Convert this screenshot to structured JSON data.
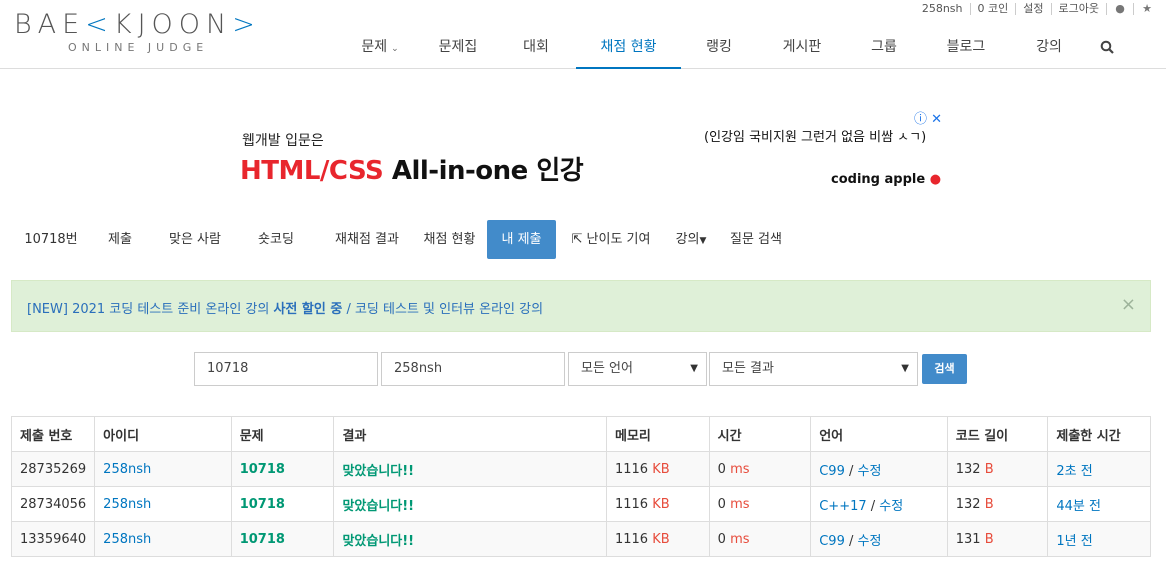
{
  "header": {
    "logo_main_left": "BAE",
    "logo_main_right": "JOON",
    "logo_sub": "ONLINE JUDGE",
    "topbar": {
      "user": "258nsh",
      "coin": "0 코인",
      "settings": "설정",
      "logout": "로그아웃",
      "globe_icon": "globe-icon",
      "star_icon": "star-icon",
      "globe_glyph": "●",
      "star_glyph": "★"
    },
    "nav": [
      {
        "label": "문제"
      },
      {
        "label": "문제집"
      },
      {
        "label": "대회"
      },
      {
        "label": "채점 현황"
      },
      {
        "label": "랭킹"
      },
      {
        "label": "게시판"
      },
      {
        "label": "그룹"
      },
      {
        "label": "블로그"
      },
      {
        "label": "강의"
      }
    ],
    "search_icon": "search-icon"
  },
  "ad": {
    "small": "웹개발 입문은",
    "big_red": "HTML/CSS",
    "big_dark": " All-in-one 인강",
    "right": "(인강임 국비지원 그런거 없음 비쌈 ㅅㄱ)",
    "brand": "coding apple",
    "info_icon": "ⓘ",
    "close_icon": "✕"
  },
  "problem_menu": {
    "items": [
      {
        "label": "10718번"
      },
      {
        "label": "제출"
      },
      {
        "label": "맞은 사람"
      },
      {
        "label": "숏코딩"
      },
      {
        "label": "재채점 결과"
      },
      {
        "label": "채점 현황"
      },
      {
        "label": "내 제출"
      },
      {
        "label": "난이도 기여"
      },
      {
        "label": "강의"
      },
      {
        "label": "질문 검색"
      }
    ]
  },
  "alert": {
    "prefix": "[NEW] 2021 코딩 테스트 준비 온라인 강의 ",
    "bold": "사전 할인 중",
    "suffix": " / 코딩 테스트 및 인터뷰 온라인 강의",
    "close": "×"
  },
  "search": {
    "problem_id": "10718",
    "user_id": "258nsh",
    "language": "모든 언어",
    "result": "모든 결과",
    "button": "검색"
  },
  "table": {
    "headers": [
      "제출 번호",
      "아이디",
      "문제",
      "결과",
      "메모리",
      "시간",
      "언어",
      "코드 길이",
      "제출한 시간"
    ],
    "rows": [
      {
        "id": "28735269",
        "user": "258nsh",
        "problem": "10718",
        "result": "맞았습니다!!",
        "memory": "1116",
        "memory_unit": "KB",
        "time": "0",
        "time_unit": "ms",
        "lang": "C99",
        "edit": "수정",
        "length": "132",
        "length_unit": "B",
        "submitted": "2초 전"
      },
      {
        "id": "28734056",
        "user": "258nsh",
        "problem": "10718",
        "result": "맞았습니다!!",
        "memory": "1116",
        "memory_unit": "KB",
        "time": "0",
        "time_unit": "ms",
        "lang": "C++17",
        "edit": "수정",
        "length": "132",
        "length_unit": "B",
        "submitted": "44분 전"
      },
      {
        "id": "13359640",
        "user": "258nsh",
        "problem": "10718",
        "result": "맞았습니다!!",
        "memory": "1116",
        "memory_unit": "KB",
        "time": "0",
        "time_unit": "ms",
        "lang": "C99",
        "edit": "수정",
        "length": "131",
        "length_unit": "B",
        "submitted": "1년 전"
      }
    ]
  },
  "colors": {
    "brand_blue": "#0076c0",
    "accepted_green": "#009874",
    "unit_red": "#e74c3c",
    "button_blue": "#428bca"
  }
}
